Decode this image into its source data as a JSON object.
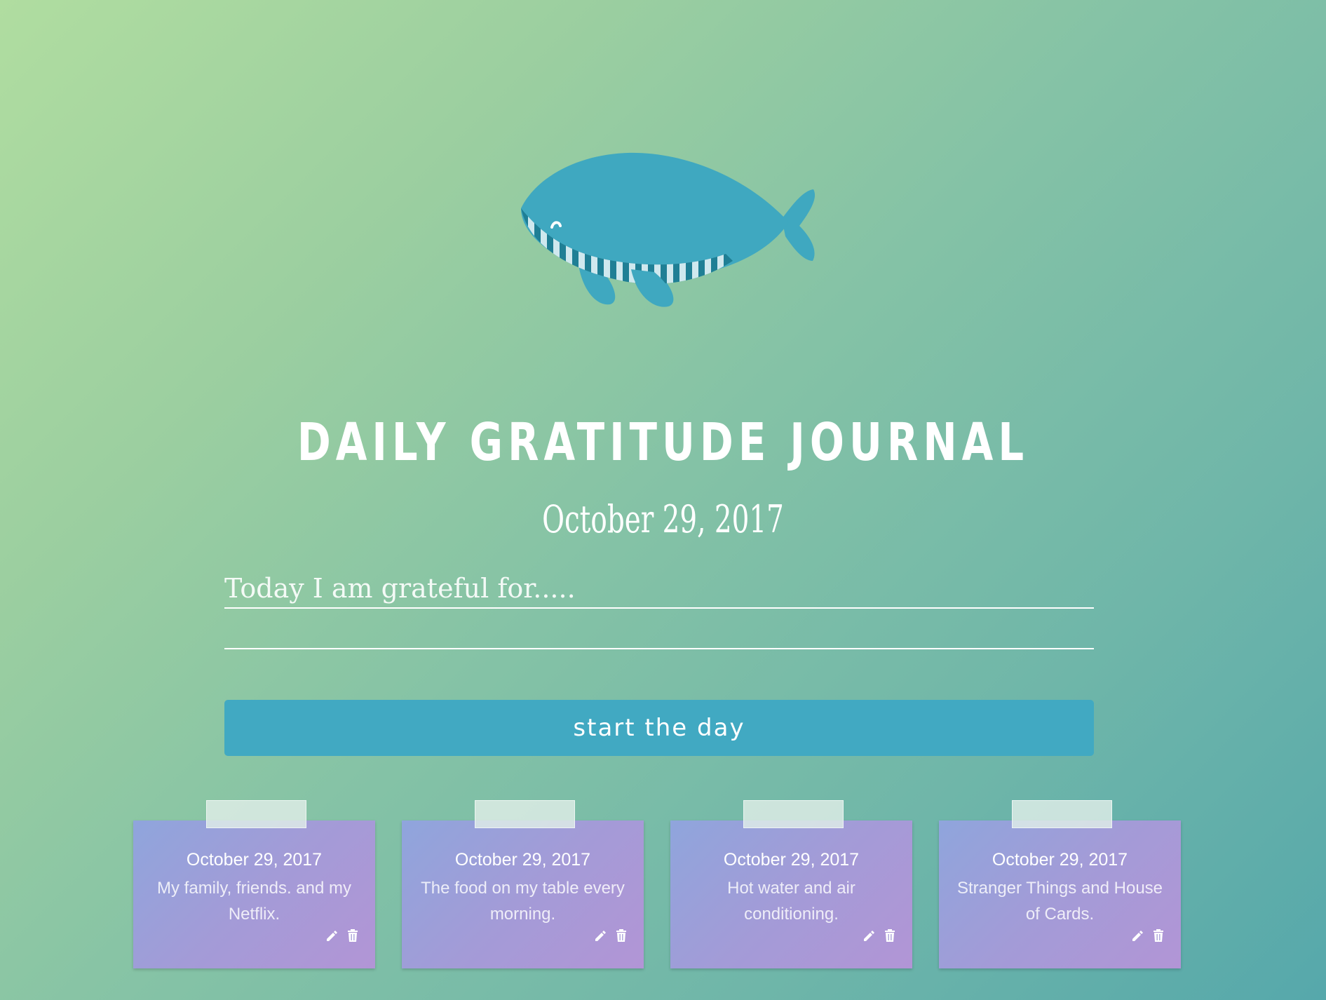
{
  "header": {
    "title": "DAILY GRATITUDE JOURNAL",
    "date": "October 29, 2017"
  },
  "form": {
    "placeholder": "Today I am grateful for.....",
    "submit_label": "start the day"
  },
  "icons": {
    "logo": "whale-icon",
    "edit": "pencil-icon",
    "delete": "trash-icon"
  },
  "colors": {
    "accent": "#41a9c2",
    "whale": "#3fa8c0",
    "card_gradient_start": "#8fa5dc",
    "card_gradient_end": "#b295d6"
  },
  "entries": [
    {
      "date": "October 29, 2017",
      "text": "My family, friends. and my Netflix."
    },
    {
      "date": "October 29, 2017",
      "text": "The food on my table every morning."
    },
    {
      "date": "October 29, 2017",
      "text": "Hot water and air conditioning."
    },
    {
      "date": "October 29, 2017",
      "text": "Stranger Things and House of Cards."
    }
  ]
}
